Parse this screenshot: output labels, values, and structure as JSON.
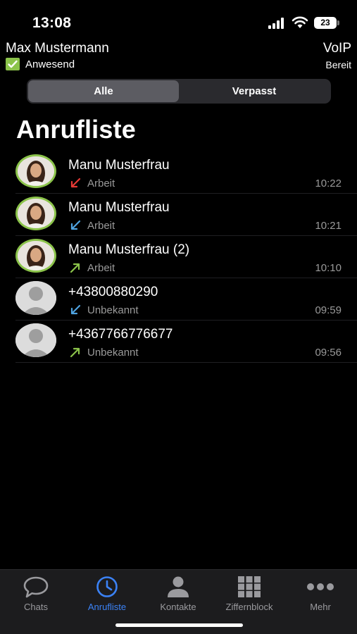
{
  "status_bar": {
    "time": "13:08",
    "battery": "23"
  },
  "header": {
    "user_name": "Max Mustermann",
    "presence": "Anwesend",
    "voip_title": "VoIP",
    "voip_status": "Bereit"
  },
  "filter": {
    "all": "Alle",
    "missed": "Verpasst",
    "selected": "Alle"
  },
  "title": "Anrufliste",
  "calls": [
    {
      "name": "Manu Musterfrau",
      "type": "Arbeit",
      "time": "10:22",
      "direction": "incoming-missed",
      "color": "#e53935",
      "avatar": "photo"
    },
    {
      "name": "Manu Musterfrau",
      "type": "Arbeit",
      "time": "10:21",
      "direction": "incoming",
      "color": "#4fa3e0",
      "avatar": "photo"
    },
    {
      "name": "Manu Musterfrau (2)",
      "type": "Arbeit",
      "time": "10:10",
      "direction": "outgoing",
      "color": "#8bc34a",
      "avatar": "photo"
    },
    {
      "name": "+43800880290",
      "type": "Unbekannt",
      "time": "09:59",
      "direction": "incoming",
      "color": "#4fa3e0",
      "avatar": "default"
    },
    {
      "name": "+4367766776677",
      "type": "Unbekannt",
      "time": "09:56",
      "direction": "outgoing",
      "color": "#8bc34a",
      "avatar": "default"
    }
  ],
  "tabs": [
    {
      "label": "Chats",
      "icon": "chat-bubble-icon"
    },
    {
      "label": "Anrufliste",
      "icon": "clock-icon",
      "active": true
    },
    {
      "label": "Kontakte",
      "icon": "person-icon"
    },
    {
      "label": "Ziffernblock",
      "icon": "keypad-icon"
    },
    {
      "label": "Mehr",
      "icon": "more-dots-icon"
    }
  ],
  "colors": {
    "accent": "#3b82f6",
    "presence": "#8bc34a",
    "background": "#000000"
  }
}
